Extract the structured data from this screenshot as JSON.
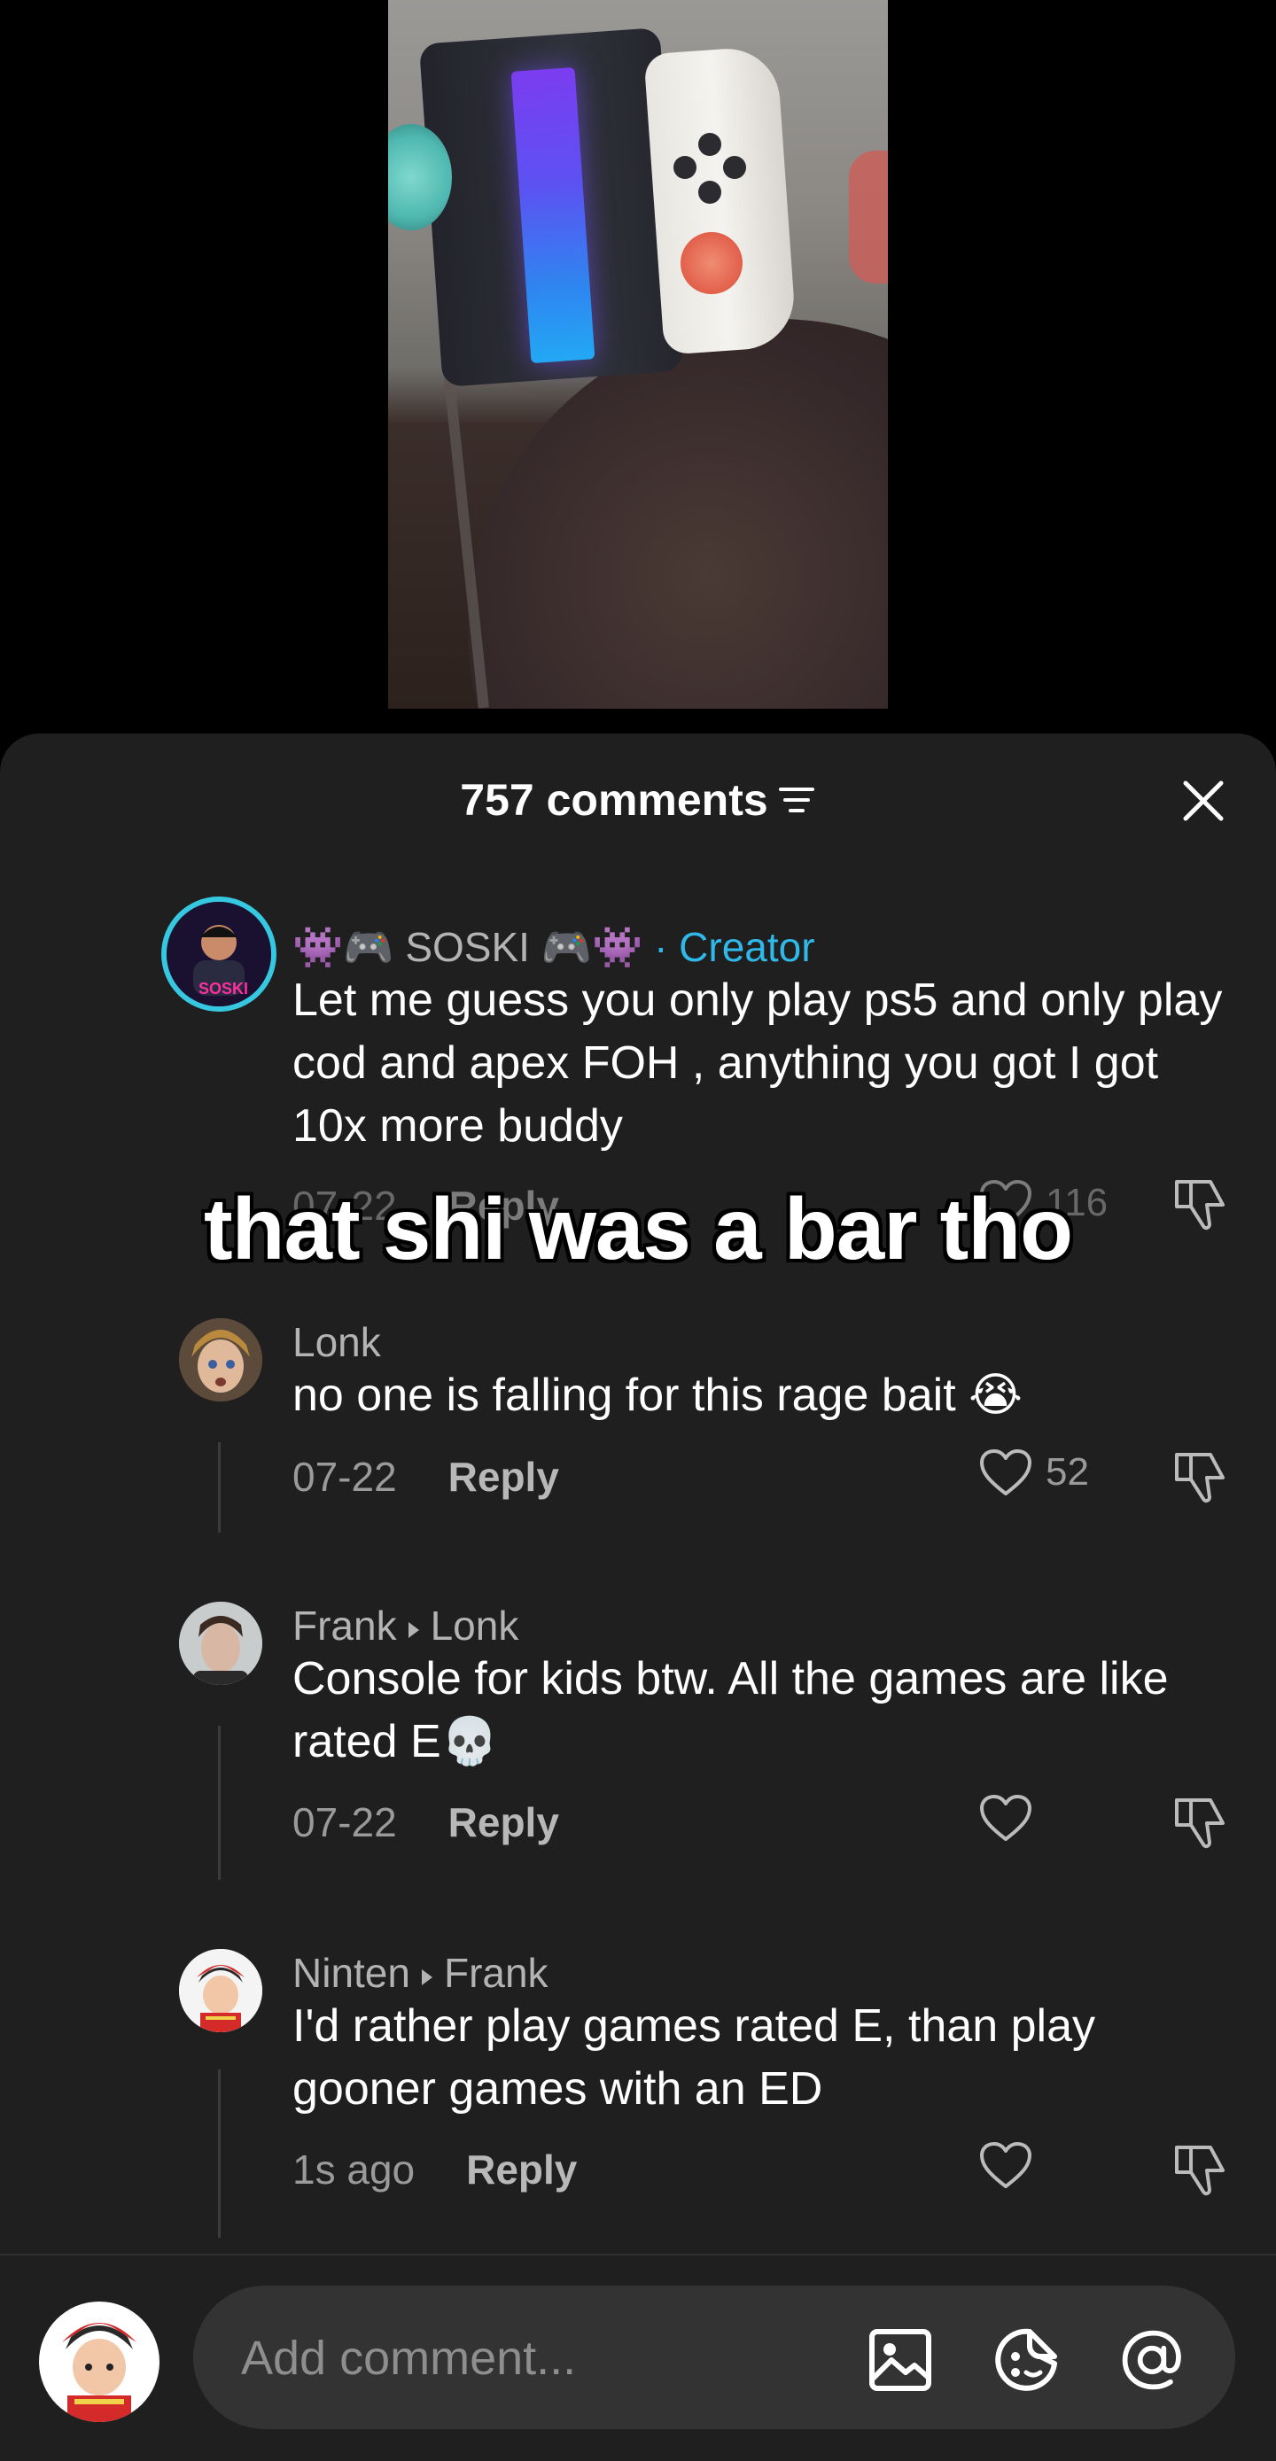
{
  "sheet": {
    "comment_count": "757 comments",
    "sort_icon": "sort-lines-icon",
    "close_icon": "close-x-icon"
  },
  "overlay_caption": "that shi was a bar tho",
  "comments": [
    {
      "user": "👾🎮 SOSKI 🎮👾",
      "badge": "· Creator",
      "text": "Let me guess you only play ps5 and only play cod and apex FOH , anything you got I got 10x more buddy",
      "date": "07-22",
      "reply": "Reply",
      "likes": "116"
    },
    {
      "user": "Lonk",
      "text": "no one is falling for this rage bait 😭",
      "date": "07-22",
      "reply": "Reply",
      "likes": "52"
    },
    {
      "user": "Frank",
      "reply_to": "Lonk",
      "text": "Console for kids btw. All the games are like rated E💀",
      "date": "07-22",
      "reply": "Reply",
      "likes": ""
    },
    {
      "user": "Ninten",
      "reply_to": "Frank",
      "text": "I'd rather play games rated E, than play gooner games with an ED",
      "date": "1s ago",
      "reply": "Reply",
      "likes": ""
    }
  ],
  "input": {
    "placeholder": "Add comment...",
    "icons": [
      "image-icon",
      "emoji-sticker-icon",
      "mention-at-icon"
    ]
  },
  "colors": {
    "sheet_bg": "#1f1f1f",
    "creator_accent": "#2fb8e8",
    "muted_text": "#9a9a9a"
  }
}
